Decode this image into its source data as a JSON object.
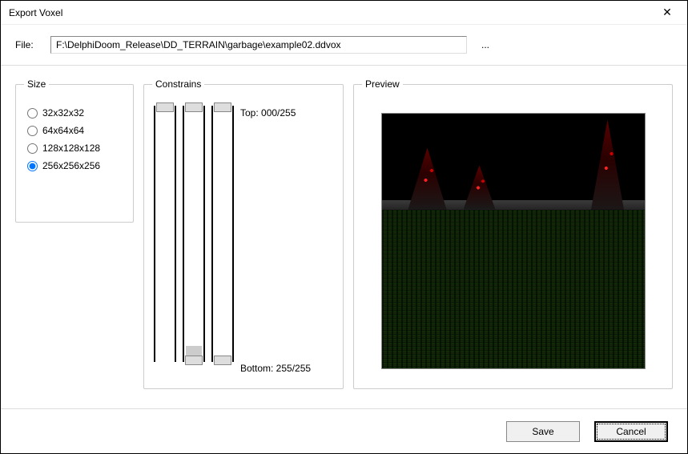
{
  "window": {
    "title": "Export Voxel"
  },
  "file": {
    "label": "File:",
    "value": "F:\\DelphiDoom_Release\\DD_TERRAIN\\garbage\\example02.ddvox",
    "browse": "..."
  },
  "size": {
    "legend": "Size",
    "options": [
      {
        "label": "32x32x32",
        "checked": false
      },
      {
        "label": "64x64x64",
        "checked": false
      },
      {
        "label": "128x128x128",
        "checked": false
      },
      {
        "label": "256x256x256",
        "checked": true
      }
    ]
  },
  "constrains": {
    "legend": "Constrains",
    "top_label": "Top: 000/255",
    "bottom_label": "Bottom: 255/255"
  },
  "preview": {
    "legend": "Preview"
  },
  "buttons": {
    "save": "Save",
    "cancel": "Cancel"
  }
}
